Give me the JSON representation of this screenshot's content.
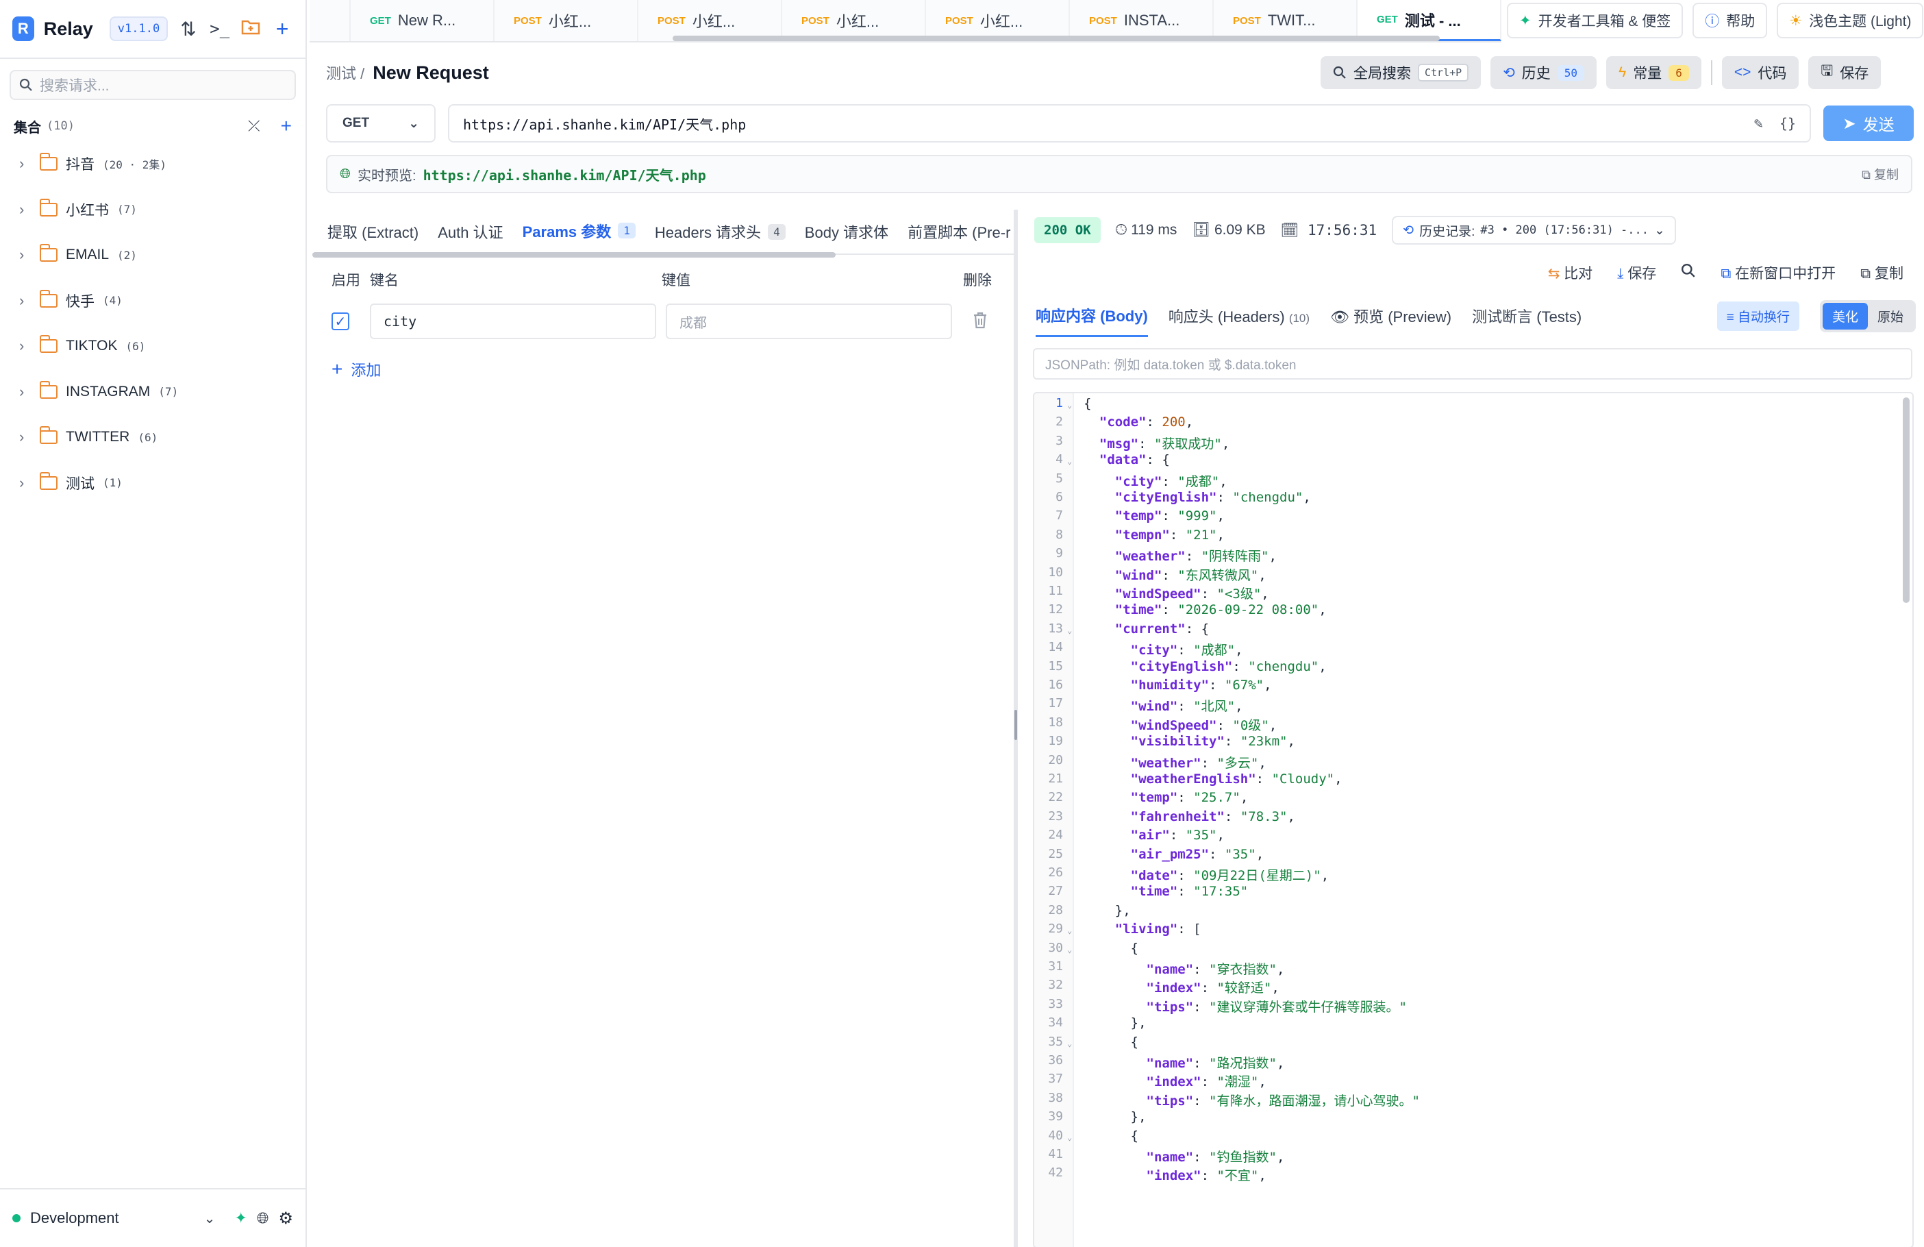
{
  "app": {
    "name": "Relay",
    "version": "v1.1.0"
  },
  "sidebar": {
    "search_placeholder": "搜索请求...",
    "collections_label": "集合",
    "collections_count": "(10)",
    "items": [
      {
        "label": "抖音",
        "count": "(20 · 2集)"
      },
      {
        "label": "小红书",
        "count": "(7)"
      },
      {
        "label": "EMAIL",
        "count": "(2)"
      },
      {
        "label": "快手",
        "count": "(4)"
      },
      {
        "label": "TIKTOK",
        "count": "(6)"
      },
      {
        "label": "INSTAGRAM",
        "count": "(7)"
      },
      {
        "label": "TWITTER",
        "count": "(6)"
      },
      {
        "label": "测试",
        "count": "(1)"
      }
    ],
    "environment": "Development"
  },
  "tabs": [
    {
      "method": "GET",
      "title": "New R..."
    },
    {
      "method": "POST",
      "title": "小红..."
    },
    {
      "method": "POST",
      "title": "小红..."
    },
    {
      "method": "POST",
      "title": "小红..."
    },
    {
      "method": "POST",
      "title": "小红..."
    },
    {
      "method": "POST",
      "title": "INSTA..."
    },
    {
      "method": "POST",
      "title": "TWIT..."
    },
    {
      "method": "GET",
      "title": "测试 - ..."
    }
  ],
  "topbar": {
    "devtools": "开发者工具箱 & 便签",
    "help": "帮助",
    "theme": "浅色主题 (Light)"
  },
  "request": {
    "breadcrumb": "测试 /",
    "title": "New Request",
    "global_search": "全局搜索",
    "shortcut": "Ctrl+P",
    "history": "历史",
    "history_count": "50",
    "constants": "常量",
    "constants_count": "6",
    "code": "代码",
    "save": "保存",
    "method": "GET",
    "url": "https://api.shanhe.kim/API/天气.php",
    "send": "发送",
    "preview_label": "实时预览:",
    "preview_url": "https://api.shanhe.kim/API/天气.php",
    "copy": "复制"
  },
  "req_tabs": [
    {
      "label": "提取 (Extract)",
      "badge": ""
    },
    {
      "label": "Auth 认证",
      "badge": ""
    },
    {
      "label": "Params 参数",
      "badge": "1"
    },
    {
      "label": "Headers 请求头",
      "badge": "4"
    },
    {
      "label": "Body 请求体",
      "badge": ""
    },
    {
      "label": "前置脚本 (Pre-r",
      "badge": ""
    }
  ],
  "params": {
    "col_enable": "启用",
    "col_key": "键名",
    "col_value": "键值",
    "col_delete": "删除",
    "row_key": "city",
    "row_value_placeholder": "成都",
    "add": "添加"
  },
  "response": {
    "status": "200 OK",
    "time": "119 ms",
    "size": "6.09 KB",
    "clock": "17:56:31",
    "history_label": "历史记录:",
    "history_value": "#3 • 200 (17:56:31) -...",
    "compare": "比对",
    "save": "保存",
    "open_new_window": "在新窗口中打开",
    "copy": "复制",
    "tab_body": "响应内容 (Body)",
    "tab_headers": "响应头 (Headers)",
    "tab_headers_count": "(10)",
    "tab_preview": "预览 (Preview)",
    "tab_tests": "测试断言 (Tests)",
    "auto_wrap": "自动换行",
    "beautify": "美化",
    "raw": "原始",
    "jsonpath_placeholder": "JSONPath: 例如 data.token 或 $.data.token"
  },
  "code_lines": [
    [
      [
        "p",
        "{"
      ]
    ],
    [
      [
        "p",
        "  "
      ],
      [
        "k",
        "\"code\""
      ],
      [
        "p",
        ": "
      ],
      [
        "n",
        "200"
      ],
      [
        "p",
        ","
      ]
    ],
    [
      [
        "p",
        "  "
      ],
      [
        "k",
        "\"msg\""
      ],
      [
        "p",
        ": "
      ],
      [
        "s",
        "\"获取成功\""
      ],
      [
        "p",
        ","
      ]
    ],
    [
      [
        "p",
        "  "
      ],
      [
        "k",
        "\"data\""
      ],
      [
        "p",
        ": {"
      ]
    ],
    [
      [
        "p",
        "    "
      ],
      [
        "k",
        "\"city\""
      ],
      [
        "p",
        ": "
      ],
      [
        "s",
        "\"成都\""
      ],
      [
        "p",
        ","
      ]
    ],
    [
      [
        "p",
        "    "
      ],
      [
        "k",
        "\"cityEnglish\""
      ],
      [
        "p",
        ": "
      ],
      [
        "s",
        "\"chengdu\""
      ],
      [
        "p",
        ","
      ]
    ],
    [
      [
        "p",
        "    "
      ],
      [
        "k",
        "\"temp\""
      ],
      [
        "p",
        ": "
      ],
      [
        "s",
        "\"999\""
      ],
      [
        "p",
        ","
      ]
    ],
    [
      [
        "p",
        "    "
      ],
      [
        "k",
        "\"tempn\""
      ],
      [
        "p",
        ": "
      ],
      [
        "s",
        "\"21\""
      ],
      [
        "p",
        ","
      ]
    ],
    [
      [
        "p",
        "    "
      ],
      [
        "k",
        "\"weather\""
      ],
      [
        "p",
        ": "
      ],
      [
        "s",
        "\"阴转阵雨\""
      ],
      [
        "p",
        ","
      ]
    ],
    [
      [
        "p",
        "    "
      ],
      [
        "k",
        "\"wind\""
      ],
      [
        "p",
        ": "
      ],
      [
        "s",
        "\"东风转微风\""
      ],
      [
        "p",
        ","
      ]
    ],
    [
      [
        "p",
        "    "
      ],
      [
        "k",
        "\"windSpeed\""
      ],
      [
        "p",
        ": "
      ],
      [
        "s",
        "\"<3级\""
      ],
      [
        "p",
        ","
      ]
    ],
    [
      [
        "p",
        "    "
      ],
      [
        "k",
        "\"time\""
      ],
      [
        "p",
        ": "
      ],
      [
        "s",
        "\"2026-09-22 08:00\""
      ],
      [
        "p",
        ","
      ]
    ],
    [
      [
        "p",
        "    "
      ],
      [
        "k",
        "\"current\""
      ],
      [
        "p",
        ": {"
      ]
    ],
    [
      [
        "p",
        "      "
      ],
      [
        "k",
        "\"city\""
      ],
      [
        "p",
        ": "
      ],
      [
        "s",
        "\"成都\""
      ],
      [
        "p",
        ","
      ]
    ],
    [
      [
        "p",
        "      "
      ],
      [
        "k",
        "\"cityEnglish\""
      ],
      [
        "p",
        ": "
      ],
      [
        "s",
        "\"chengdu\""
      ],
      [
        "p",
        ","
      ]
    ],
    [
      [
        "p",
        "      "
      ],
      [
        "k",
        "\"humidity\""
      ],
      [
        "p",
        ": "
      ],
      [
        "s",
        "\"67%\""
      ],
      [
        "p",
        ","
      ]
    ],
    [
      [
        "p",
        "      "
      ],
      [
        "k",
        "\"wind\""
      ],
      [
        "p",
        ": "
      ],
      [
        "s",
        "\"北风\""
      ],
      [
        "p",
        ","
      ]
    ],
    [
      [
        "p",
        "      "
      ],
      [
        "k",
        "\"windSpeed\""
      ],
      [
        "p",
        ": "
      ],
      [
        "s",
        "\"0级\""
      ],
      [
        "p",
        ","
      ]
    ],
    [
      [
        "p",
        "      "
      ],
      [
        "k",
        "\"visibility\""
      ],
      [
        "p",
        ": "
      ],
      [
        "s",
        "\"23km\""
      ],
      [
        "p",
        ","
      ]
    ],
    [
      [
        "p",
        "      "
      ],
      [
        "k",
        "\"weather\""
      ],
      [
        "p",
        ": "
      ],
      [
        "s",
        "\"多云\""
      ],
      [
        "p",
        ","
      ]
    ],
    [
      [
        "p",
        "      "
      ],
      [
        "k",
        "\"weatherEnglish\""
      ],
      [
        "p",
        ": "
      ],
      [
        "s",
        "\"Cloudy\""
      ],
      [
        "p",
        ","
      ]
    ],
    [
      [
        "p",
        "      "
      ],
      [
        "k",
        "\"temp\""
      ],
      [
        "p",
        ": "
      ],
      [
        "s",
        "\"25.7\""
      ],
      [
        "p",
        ","
      ]
    ],
    [
      [
        "p",
        "      "
      ],
      [
        "k",
        "\"fahrenheit\""
      ],
      [
        "p",
        ": "
      ],
      [
        "s",
        "\"78.3\""
      ],
      [
        "p",
        ","
      ]
    ],
    [
      [
        "p",
        "      "
      ],
      [
        "k",
        "\"air\""
      ],
      [
        "p",
        ": "
      ],
      [
        "s",
        "\"35\""
      ],
      [
        "p",
        ","
      ]
    ],
    [
      [
        "p",
        "      "
      ],
      [
        "k",
        "\"air_pm25\""
      ],
      [
        "p",
        ": "
      ],
      [
        "s",
        "\"35\""
      ],
      [
        "p",
        ","
      ]
    ],
    [
      [
        "p",
        "      "
      ],
      [
        "k",
        "\"date\""
      ],
      [
        "p",
        ": "
      ],
      [
        "s",
        "\"09月22日(星期二)\""
      ],
      [
        "p",
        ","
      ]
    ],
    [
      [
        "p",
        "      "
      ],
      [
        "k",
        "\"time\""
      ],
      [
        "p",
        ": "
      ],
      [
        "s",
        "\"17:35\""
      ]
    ],
    [
      [
        "p",
        "    },"
      ]
    ],
    [
      [
        "p",
        "    "
      ],
      [
        "k",
        "\"living\""
      ],
      [
        "p",
        ": ["
      ]
    ],
    [
      [
        "p",
        "      {"
      ]
    ],
    [
      [
        "p",
        "        "
      ],
      [
        "k",
        "\"name\""
      ],
      [
        "p",
        ": "
      ],
      [
        "s",
        "\"穿衣指数\""
      ],
      [
        "p",
        ","
      ]
    ],
    [
      [
        "p",
        "        "
      ],
      [
        "k",
        "\"index\""
      ],
      [
        "p",
        ": "
      ],
      [
        "s",
        "\"较舒适\""
      ],
      [
        "p",
        ","
      ]
    ],
    [
      [
        "p",
        "        "
      ],
      [
        "k",
        "\"tips\""
      ],
      [
        "p",
        ": "
      ],
      [
        "s",
        "\"建议穿薄外套或牛仔裤等服装。\""
      ]
    ],
    [
      [
        "p",
        "      },"
      ]
    ],
    [
      [
        "p",
        "      {"
      ]
    ],
    [
      [
        "p",
        "        "
      ],
      [
        "k",
        "\"name\""
      ],
      [
        "p",
        ": "
      ],
      [
        "s",
        "\"路况指数\""
      ],
      [
        "p",
        ","
      ]
    ],
    [
      [
        "p",
        "        "
      ],
      [
        "k",
        "\"index\""
      ],
      [
        "p",
        ": "
      ],
      [
        "s",
        "\"潮湿\""
      ],
      [
        "p",
        ","
      ]
    ],
    [
      [
        "p",
        "        "
      ],
      [
        "k",
        "\"tips\""
      ],
      [
        "p",
        ": "
      ],
      [
        "s",
        "\"有降水，路面潮湿，请小心驾驶。\""
      ]
    ],
    [
      [
        "p",
        "      },"
      ]
    ],
    [
      [
        "p",
        "      {"
      ]
    ],
    [
      [
        "p",
        "        "
      ],
      [
        "k",
        "\"name\""
      ],
      [
        "p",
        ": "
      ],
      [
        "s",
        "\"钓鱼指数\""
      ],
      [
        "p",
        ","
      ]
    ],
    [
      [
        "p",
        "        "
      ],
      [
        "k",
        "\"index\""
      ],
      [
        "p",
        ": "
      ],
      [
        "s",
        "\"不宜\""
      ],
      [
        "p",
        ","
      ]
    ]
  ],
  "fold_lines": [
    1,
    4,
    13,
    29,
    30,
    35,
    40
  ],
  "colors": {
    "accent": "#3b82f6",
    "get": "#10b981",
    "post": "#f59e0b",
    "ok": "#047857"
  }
}
